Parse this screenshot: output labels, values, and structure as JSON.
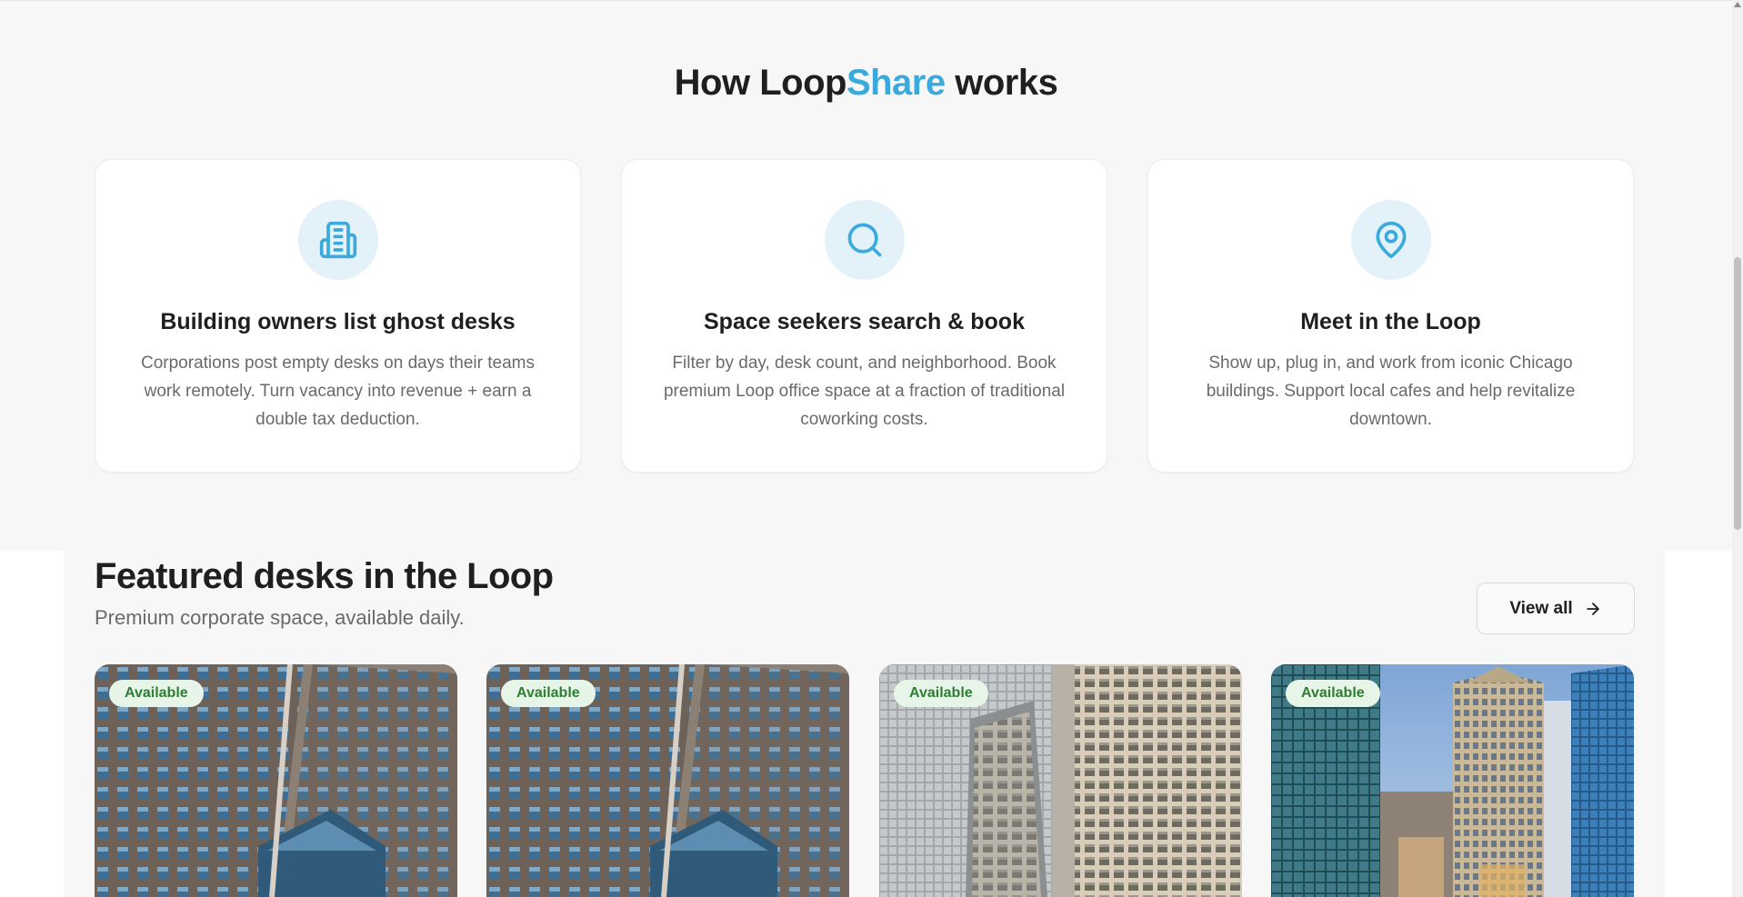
{
  "how": {
    "title_part1": "How Loop",
    "title_accent": "Share",
    "title_part2": " works",
    "steps": [
      {
        "icon": "building-icon",
        "title": "Building owners list ghost desks",
        "desc": "Corporations post empty desks on days their teams work remotely. Turn vacancy into revenue + earn a double tax deduction."
      },
      {
        "icon": "search-icon",
        "title": "Space seekers search & book",
        "desc": "Filter by day, desk count, and neighborhood. Book premium Loop office space at a fraction of traditional coworking costs."
      },
      {
        "icon": "map-pin-icon",
        "title": "Meet in the Loop",
        "desc": "Show up, plug in, and work from iconic Chicago buildings. Support local cafes and help revitalize downtown."
      }
    ]
  },
  "featured": {
    "title": "Featured desks in the Loop",
    "subtitle": "Premium corporate space, available daily.",
    "view_all_label": "View all",
    "cards": [
      {
        "badge": "Available"
      },
      {
        "badge": "Available"
      },
      {
        "badge": "Available"
      },
      {
        "badge": "Available"
      }
    ]
  },
  "colors": {
    "accent": "#3aa9dc",
    "badge_bg": "#e7f5e9",
    "badge_text": "#2e7d32"
  }
}
